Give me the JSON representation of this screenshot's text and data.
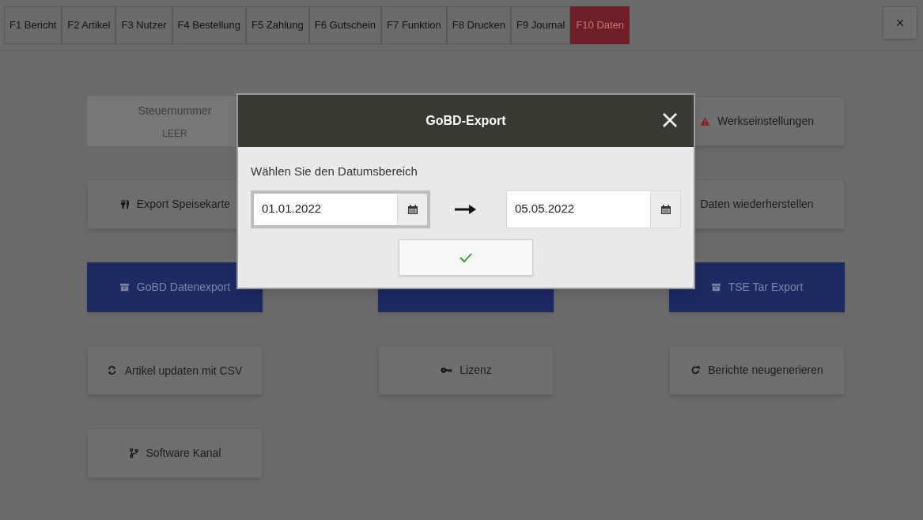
{
  "tabs": [
    {
      "label": "F1 Bericht",
      "selected": false
    },
    {
      "label": "F2 Artikel",
      "selected": false
    },
    {
      "label": "F3 Nutzer",
      "selected": false
    },
    {
      "label": "F4 Bestellung",
      "selected": false
    },
    {
      "label": "F5 Zahlung",
      "selected": false
    },
    {
      "label": "F6 Gutschein",
      "selected": false
    },
    {
      "label": "F7 Funktion",
      "selected": false
    },
    {
      "label": "F8 Drucken",
      "selected": false
    },
    {
      "label": "F9 Journal",
      "selected": false
    },
    {
      "label": "F10 Daten",
      "selected": true
    }
  ],
  "close_button": "×",
  "buttons": [
    {
      "kind": "disabled",
      "label": "Steuernummer",
      "sublabel": "LEER"
    },
    {
      "kind": "normal",
      "label": "Werkseinstellungen"
    },
    {
      "kind": "normal",
      "label": "Export Speisekarte"
    },
    {
      "kind": "normal",
      "label": "Daten wiederherstellen"
    },
    {
      "kind": "primary",
      "label": "GoBD Datenexport"
    },
    {
      "kind": "primary"
    },
    {
      "kind": "primary",
      "label": "TSE Tar Export"
    },
    {
      "kind": "normal",
      "label": "Artikel updaten mit CSV"
    },
    {
      "kind": "normal",
      "label": "Lizenz"
    },
    {
      "kind": "normal",
      "label": "Berichte neugenerieren"
    },
    {
      "kind": "normal",
      "label": "Software Kanal"
    }
  ],
  "dialog": {
    "title": "GoBD-Export",
    "prompt": "Wählen Sie den Datumsbereich",
    "from": {
      "value": "01.01.2022",
      "focused": true
    },
    "to": {
      "value": "05.05.2022",
      "focused": false
    }
  }
}
